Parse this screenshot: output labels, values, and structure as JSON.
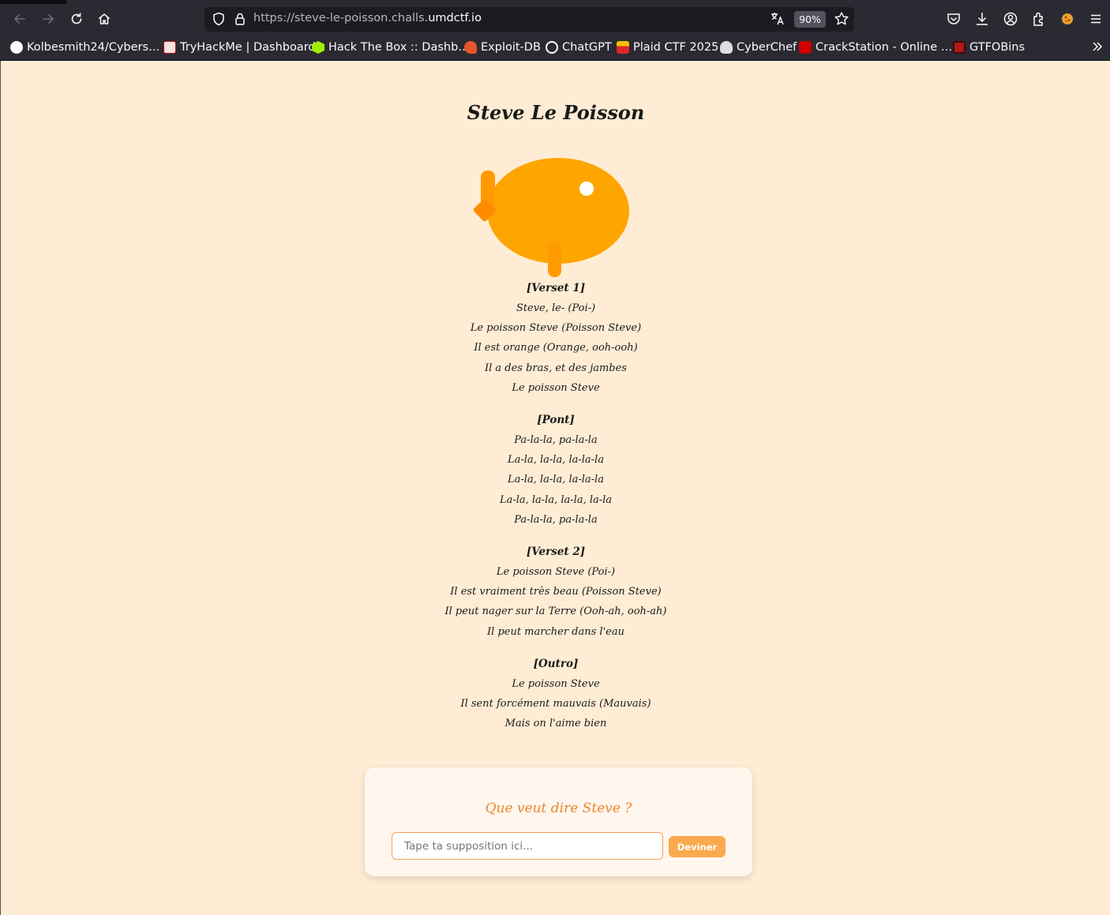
{
  "browser": {
    "url_prefix": "https://steve-le-poisson.challs.",
    "url_domain": "umdctf.io",
    "zoom": "90%",
    "bookmarks": [
      {
        "label": "Kolbesmith24/Cybers…",
        "icon": "github-icon",
        "color": "#ffffff"
      },
      {
        "label": "TryHackMe | Dashboard",
        "icon": "tryhackme-icon",
        "color": "#c11111"
      },
      {
        "label": "Hack The Box :: Dashb…",
        "icon": "hackthebox-icon",
        "color": "#9fef00"
      },
      {
        "label": "Exploit-DB",
        "icon": "exploitdb-icon",
        "color": "#e8572a"
      },
      {
        "label": "ChatGPT",
        "icon": "chatgpt-icon",
        "color": "#ffffff"
      },
      {
        "label": "Plaid CTF 2025",
        "icon": "plaidctf-icon",
        "color": "#e0262b"
      },
      {
        "label": "CyberChef",
        "icon": "cyberchef-icon",
        "color": "#dddddd"
      },
      {
        "label": "CrackStation - Online …",
        "icon": "crackstation-icon",
        "color": "#d00000"
      },
      {
        "label": "GTFOBins",
        "icon": "gtfobins-icon",
        "color": "#b01818"
      }
    ]
  },
  "page": {
    "title": "Steve Le Poisson",
    "fish_color": "#ffa500",
    "stanzas": [
      {
        "head": "[Verset 1]",
        "lines": [
          "Steve, le- (Poi-)",
          "Le poisson Steve (Poisson Steve)",
          "Il est orange (Orange, ooh-ooh)",
          "Il a des bras, et des jambes",
          "Le poisson Steve"
        ]
      },
      {
        "head": "[Pont]",
        "lines": [
          "Pa-la-la, pa-la-la",
          "La-la, la-la, la-la-la",
          "La-la, la-la, la-la-la",
          "La-la, la-la, la-la, la-la",
          "Pa-la-la, pa-la-la"
        ]
      },
      {
        "head": "[Verset 2]",
        "lines": [
          "Le poisson Steve (Poi-)",
          "Il est vraiment très beau (Poisson Steve)",
          "Il peut nager sur la Terre (Ooh-ah, ooh-ah)",
          "Il peut marcher dans l'eau"
        ]
      },
      {
        "head": "[Outro]",
        "lines": [
          "Le poisson Steve",
          "Il sent forcément mauvais (Mauvais)",
          "Mais on l'aime bien"
        ]
      }
    ],
    "guess": {
      "question": "Que veut dire Steve ?",
      "placeholder": "Tape ta supposition ici...",
      "value": "",
      "button": "Deviner"
    }
  }
}
